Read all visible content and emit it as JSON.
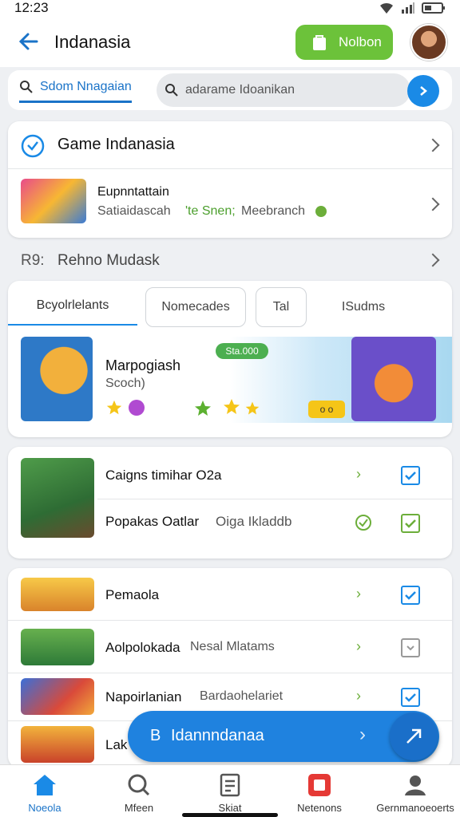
{
  "status": {
    "time": "12:23"
  },
  "header": {
    "title": "Indanasia",
    "button_label": "Nolbon"
  },
  "search": {
    "tab_label": "Sdom Nnagaian",
    "placeholder": "adarame Idoanikan"
  },
  "section1": {
    "heading": "Game Indanasia",
    "item_title": "Eupnntattain",
    "item_sub_a": "Satiaidascah",
    "item_sub_b": "'te Snen;",
    "item_sub_c": "Meebranch"
  },
  "section2": {
    "prefix": "R9:",
    "heading": "Rehno Mudask",
    "tabs": [
      "Bcyolrlelants",
      "Nomecades",
      "Tal",
      "ISudms"
    ],
    "featured_badge": "Sta.000",
    "featured_title": "Marpogiash",
    "featured_sub": "Scoch)",
    "featured_pill": "o o"
  },
  "list1": [
    {
      "title": "Caigns timihar O2a",
      "sub": ""
    },
    {
      "title": "Popakas Oatlar",
      "sub": "Oiga Ikladdb"
    }
  ],
  "list2": [
    {
      "title": "Pemaola",
      "sub": ""
    },
    {
      "title": "Aolpolokada",
      "sub": "Nesal Mlatams"
    },
    {
      "title": "Napoirlanian",
      "sub": "Bardaohelariet"
    },
    {
      "title": "Lak",
      "sub": ""
    }
  ],
  "fab": {
    "label": "Idannndanaa",
    "prefix": "B"
  },
  "nav": [
    "Noeola",
    "Mfeen",
    "Skiat",
    "Netenons",
    "Gernmanoeoerts"
  ],
  "colors": {
    "accent": "#1a8ae6",
    "green": "#6cc23a"
  }
}
